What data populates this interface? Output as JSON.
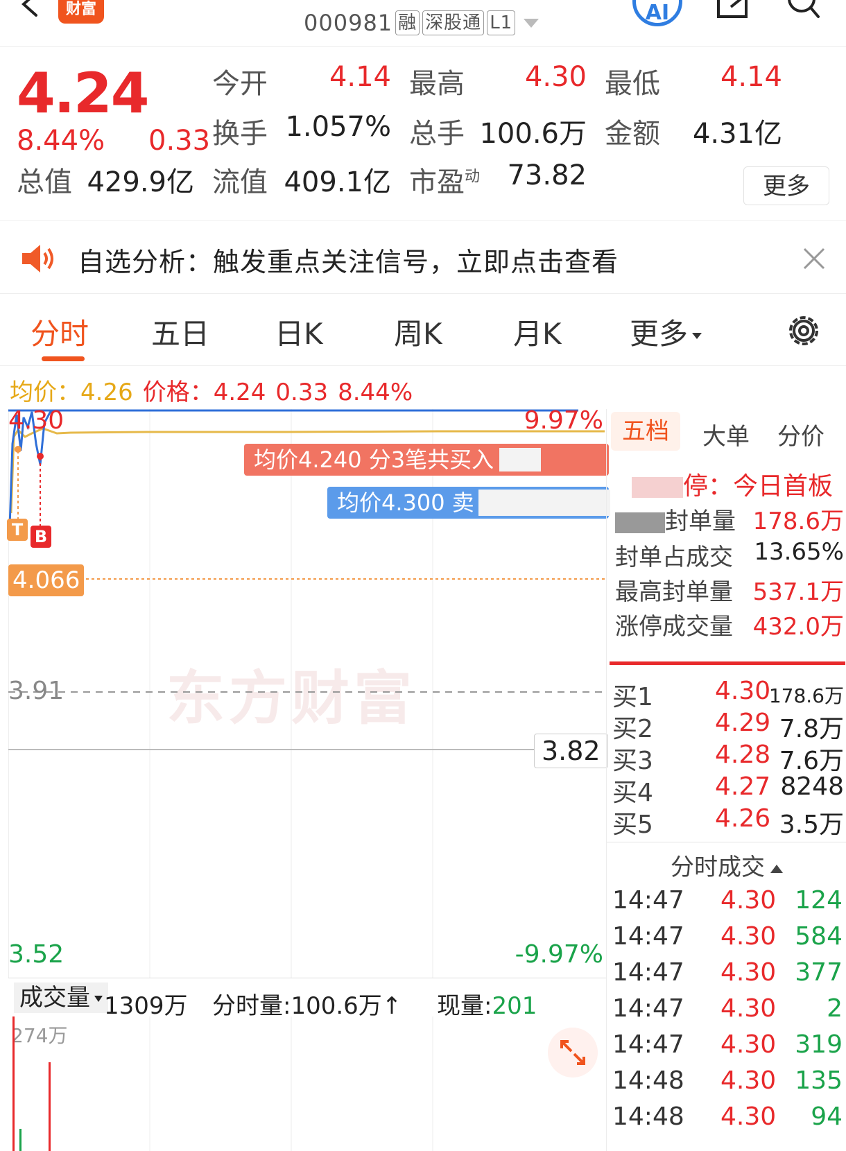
{
  "header": {
    "logo_text": "财富",
    "code": "000981",
    "tags": [
      "融",
      "深股通",
      "L1"
    ],
    "ai_label": "AI"
  },
  "quote": {
    "price": "4.24",
    "change_pct": "8.44%",
    "change": "0.33",
    "fields": [
      {
        "label": "今开",
        "value": "4.14",
        "color": "red"
      },
      {
        "label": "最高",
        "value": "4.30",
        "color": "red"
      },
      {
        "label": "最低",
        "value": "4.14",
        "color": "red"
      },
      {
        "label": "换手",
        "value": "1.057%",
        "color": "dark"
      },
      {
        "label": "总手",
        "value": "100.6万",
        "color": "dark"
      },
      {
        "label": "金额",
        "value": "4.31亿",
        "color": "dark"
      },
      {
        "label": "总值",
        "value": "429.9亿",
        "color": "dark"
      },
      {
        "label": "流值",
        "value": "409.1亿",
        "color": "dark"
      },
      {
        "label": "市盈",
        "sup": "动",
        "value": "73.82",
        "color": "dark"
      }
    ],
    "more_label": "更多"
  },
  "alert": {
    "text": "自选分析：触发重点关注信号，立即点击查看"
  },
  "tabs": {
    "items": [
      "分时",
      "五日",
      "日K",
      "周K",
      "月K",
      "更多"
    ],
    "active_index": 0
  },
  "info_line": {
    "avg_label": "均价：",
    "avg_value": "4.26",
    "price_label": "价格：",
    "price_value": "4.24",
    "change": "0.33",
    "change_pct": "8.44%"
  },
  "chart": {
    "y_top": "4.30",
    "y_top_pct": "9.97%",
    "y_prev_close_marker": "4.066",
    "y_mid": "3.91",
    "y_ref": "3.82",
    "y_bottom": "3.52",
    "y_bottom_pct": "-9.97%",
    "watermark": "东方财富",
    "tip_buy": "均价4.240  分3笔共买入",
    "tip_sell": "均价4.300  卖",
    "badge_t": "T",
    "badge_b": "B",
    "colors": {
      "price_line": "#2f6fd8",
      "avg_line": "#e6b94a",
      "up": "#e8292b",
      "down": "#1aa34a"
    }
  },
  "volume": {
    "type_label": "成交量",
    "total": "1309万",
    "fenshi_label": "分时量:",
    "fenshi_value": "100.6万",
    "fenshi_arrow": "↑",
    "now_label": "现量:",
    "now_value": "201",
    "max_label": "274万"
  },
  "right_panel": {
    "tabs": [
      "五档",
      "大单",
      "分价"
    ],
    "active_tab": 0,
    "limit_up_title": "停：今日首板",
    "limit_up_rows": [
      {
        "label": "封单量",
        "value": "178.6万"
      },
      {
        "label": "封单占成交",
        "value": "13.65%"
      },
      {
        "label": "最高封单量",
        "value": "537.1万"
      },
      {
        "label": "涨停成交量",
        "value": "432.0万"
      }
    ],
    "order_book": [
      {
        "label": "买1",
        "price": "4.30",
        "volume": "178.6万"
      },
      {
        "label": "买2",
        "price": "4.29",
        "volume": "7.8万"
      },
      {
        "label": "买3",
        "price": "4.28",
        "volume": "7.6万"
      },
      {
        "label": "买4",
        "price": "4.27",
        "volume": "8248"
      },
      {
        "label": "买5",
        "price": "4.26",
        "volume": "3.5万"
      }
    ],
    "ticks_header": "分时成交",
    "ticks": [
      {
        "time": "14:47",
        "price": "4.30",
        "qty": "124"
      },
      {
        "time": "14:47",
        "price": "4.30",
        "qty": "584"
      },
      {
        "time": "14:47",
        "price": "4.30",
        "qty": "377"
      },
      {
        "time": "14:47",
        "price": "4.30",
        "qty": "2"
      },
      {
        "time": "14:47",
        "price": "4.30",
        "qty": "319"
      },
      {
        "time": "14:48",
        "price": "4.30",
        "qty": "135"
      },
      {
        "time": "14:48",
        "price": "4.30",
        "qty": "94"
      }
    ]
  }
}
